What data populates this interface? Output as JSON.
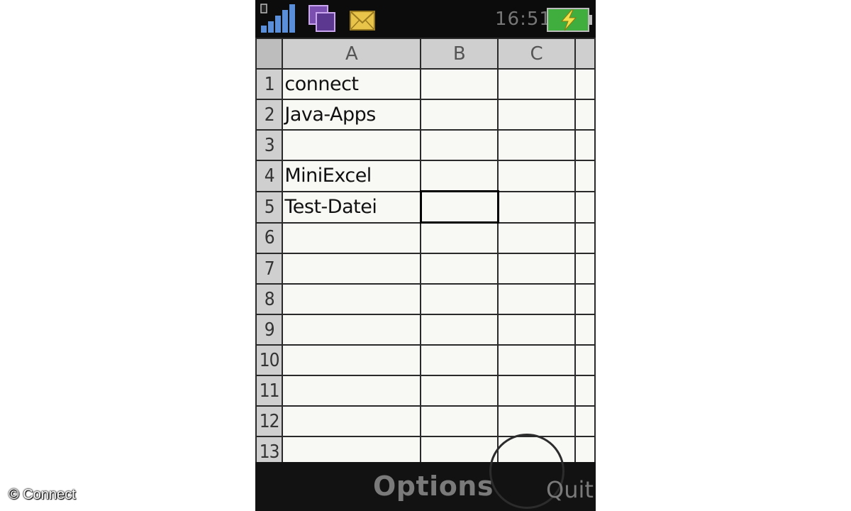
{
  "status": {
    "time": "16:51",
    "icons": [
      "signal-strength-icon",
      "multitask-icon",
      "message-envelope-icon",
      "battery-charging-icon"
    ]
  },
  "sheet": {
    "columns": [
      "A",
      "B",
      "C"
    ],
    "rows": [
      {
        "num": "1",
        "cells": [
          "connect",
          "",
          ""
        ]
      },
      {
        "num": "2",
        "cells": [
          "Java-Apps",
          "",
          ""
        ]
      },
      {
        "num": "3",
        "cells": [
          "",
          "",
          ""
        ]
      },
      {
        "num": "4",
        "cells": [
          "MiniExcel",
          "",
          ""
        ]
      },
      {
        "num": "5",
        "cells": [
          "Test-Datei",
          "",
          ""
        ]
      },
      {
        "num": "6",
        "cells": [
          "",
          "",
          ""
        ]
      },
      {
        "num": "7",
        "cells": [
          "",
          "",
          ""
        ]
      },
      {
        "num": "8",
        "cells": [
          "",
          "",
          ""
        ]
      },
      {
        "num": "9",
        "cells": [
          "",
          "",
          ""
        ]
      },
      {
        "num": "10",
        "cells": [
          "",
          "",
          ""
        ]
      },
      {
        "num": "11",
        "cells": [
          "",
          "",
          ""
        ]
      },
      {
        "num": "12",
        "cells": [
          "",
          "",
          ""
        ]
      },
      {
        "num": "13",
        "cells": [
          "",
          "",
          ""
        ]
      }
    ],
    "selected_cell": "B5"
  },
  "softkeys": {
    "center": "Options",
    "right": "Quit"
  },
  "watermark": "© Connect"
}
